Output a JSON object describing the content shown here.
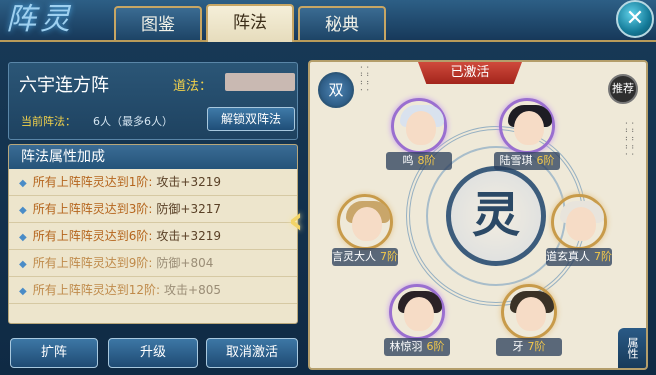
{
  "header": {
    "logo_text": "阵灵",
    "tabs": [
      {
        "label": "图鉴",
        "active": false
      },
      {
        "label": "阵法",
        "active": true
      },
      {
        "label": "秘典",
        "active": false
      }
    ],
    "close_icon": "close-icon"
  },
  "formation": {
    "name": "六宇连方阵",
    "dao_label": "道法：",
    "current_label": "当前阵法：",
    "current_value": "6人（最多6人）",
    "unlock_label": "解锁双阵法"
  },
  "attributes": {
    "title": "阵法属性加成",
    "rows": [
      {
        "condition": "所有上阵阵灵达到1阶:",
        "effect": "攻击+3219",
        "locked": false
      },
      {
        "condition": "所有上阵阵灵达到3阶:",
        "effect": "防御+3217",
        "locked": false
      },
      {
        "condition": "所有上阵阵灵达到6阶:",
        "effect": "攻击+3219",
        "locked": false
      },
      {
        "condition": "所有上阵阵灵达到9阶:",
        "effect": "防御+804",
        "locked": true
      },
      {
        "condition": "所有上阵阵灵达到12阶:",
        "effect": "攻击+805",
        "locked": true
      }
    ]
  },
  "buttons": {
    "expand": "扩阵",
    "upgrade": "升级",
    "cancel": "取消激活",
    "info": "!"
  },
  "array": {
    "status": "已激活",
    "dual_badge": "双",
    "recommend": "推荐",
    "center_glyph": "灵",
    "attr_corner": "属性",
    "arrow": "‹",
    "characters": [
      {
        "name": "鸣",
        "rank": "8阶",
        "hair": "#d9e2ee",
        "frame": "purple"
      },
      {
        "name": "陆雪琪",
        "rank": "6阶",
        "hair": "#1d1d24",
        "frame": "purple"
      },
      {
        "name": "言灵大人",
        "rank": "7阶",
        "hair": "#c9a66a",
        "frame": "gold"
      },
      {
        "name": "道玄真人",
        "rank": "7阶",
        "hair": "#e8e4dc",
        "frame": "gold"
      },
      {
        "name": "林惊羽",
        "rank": "6阶",
        "hair": "#2a2226",
        "frame": "purple"
      },
      {
        "name": "牙",
        "rank": "7阶",
        "hair": "#3a3226",
        "frame": "gold"
      }
    ]
  }
}
